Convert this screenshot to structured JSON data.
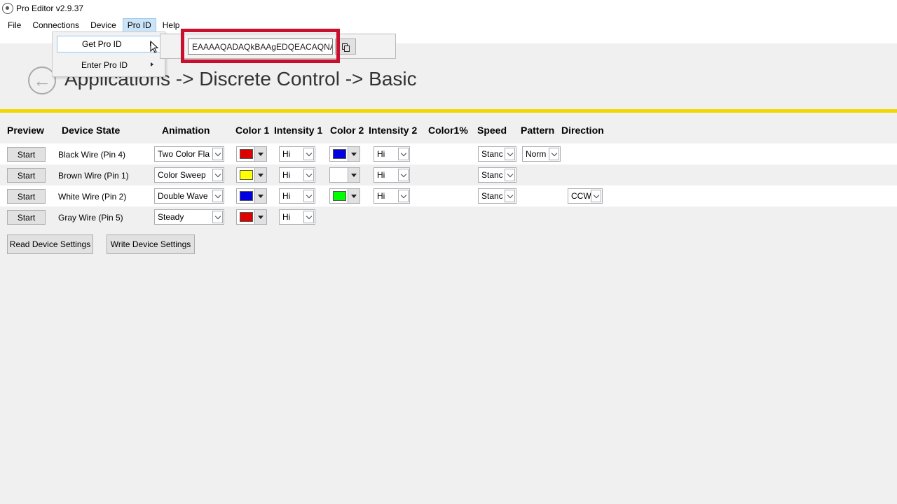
{
  "window": {
    "title": "Pro Editor v2.9.37"
  },
  "menu": [
    "File",
    "Connections",
    "Device",
    "Pro ID",
    "Help"
  ],
  "pro_id_menu": {
    "items": [
      "Get Pro ID",
      "Enter Pro ID"
    ],
    "pro_id_value": "EAAAAQADAQkBAAgEDQEACAQNAC"
  },
  "breadcrumb": "Applications -> Discrete Control -> Basic",
  "columns": {
    "preview": "Preview",
    "device_state": "Device State",
    "animation": "Animation",
    "color1": "Color 1",
    "intensity1": "Intensity 1",
    "color2": "Color 2",
    "intensity2": "Intensity 2",
    "color_pct": "Color1%",
    "speed": "Speed",
    "pattern": "Pattern",
    "direction": "Direction"
  },
  "rows": [
    {
      "start": "Start",
      "device": "Black Wire (Pin 4)",
      "animation": "Two Color Fla",
      "color1": "#e00000",
      "intensity1": "Hi",
      "color2": "#0000e0",
      "intensity2": "Hi",
      "speed": "Stanc",
      "pattern": "Norm",
      "direction": ""
    },
    {
      "start": "Start",
      "device": "Brown Wire (Pin 1)",
      "animation": "Color Sweep",
      "color1": "#ffff00",
      "intensity1": "Hi",
      "color2": "#ffffff",
      "intensity2": "Hi",
      "speed": "Stanc",
      "pattern": "",
      "direction": ""
    },
    {
      "start": "Start",
      "device": "White Wire (Pin 2)",
      "animation": "Double Wave",
      "color1": "#0000e0",
      "intensity1": "Hi",
      "color2": "#00ff00",
      "intensity2": "Hi",
      "speed": "Stanc",
      "pattern": "",
      "direction": "CCW"
    },
    {
      "start": "Start",
      "device": "Gray Wire (Pin 5)",
      "animation": "Steady",
      "color1": "#e00000",
      "intensity1": "Hi",
      "color2": "",
      "intensity2": "",
      "speed": "",
      "pattern": "",
      "direction": ""
    }
  ],
  "actions": {
    "read": "Read Device Settings",
    "write": "Write Device Settings"
  },
  "colors": {
    "accent_bar": "#f0d800",
    "highlight": "#c8102e",
    "menu_active": "#cce4f7"
  }
}
